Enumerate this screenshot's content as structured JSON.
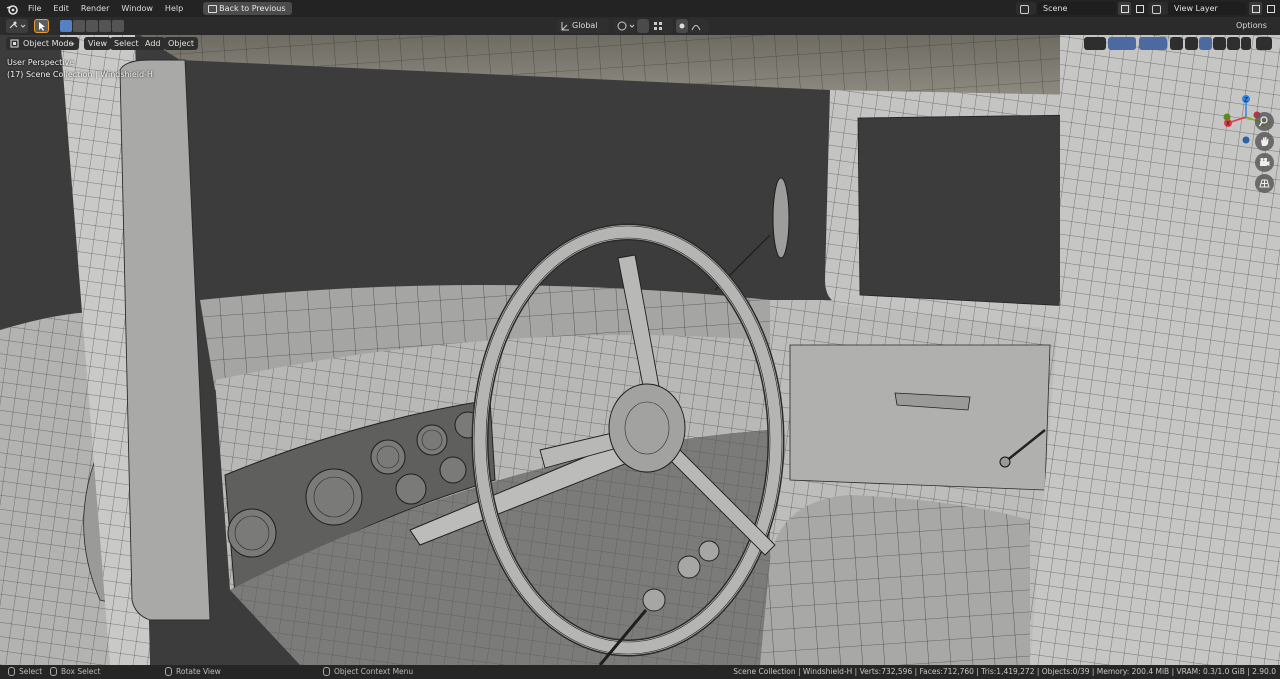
{
  "menu": [
    "File",
    "Edit",
    "Render",
    "Window",
    "Help"
  ],
  "back_button": "Back to Previous",
  "scene": {
    "label": "Scene",
    "view_layer": "View Layer"
  },
  "options_label": "Options",
  "transform": {
    "orientation": "Global"
  },
  "viewport_header": {
    "mode": "Object Mode",
    "menus": [
      "View",
      "Select",
      "Add",
      "Object"
    ]
  },
  "overlay": {
    "perspective": "User Perspective",
    "collection": "(17) Scene Collection | Windshield-H"
  },
  "gizmo_axes": {
    "x": "X",
    "y": "Y",
    "z": "Z"
  },
  "statusbar": {
    "select": "Select",
    "box_select": "Box Select",
    "rotate_view": "Rotate View",
    "context_menu": "Object Context Menu",
    "stats": "Scene Collection | Windshield-H | Verts:732,596 | Faces:712,760 | Tris:1,419,272 | Objects:0/39 | Memory: 200.4 MiB | VRAM: 0.3/1.0 GiB | 2.90.0"
  },
  "colors": {
    "accent_orange": "#e89b2f",
    "active_blue": "#5680c2",
    "axis_x": "#e2394d",
    "axis_y": "#82b01e",
    "axis_z": "#2f86e6"
  }
}
